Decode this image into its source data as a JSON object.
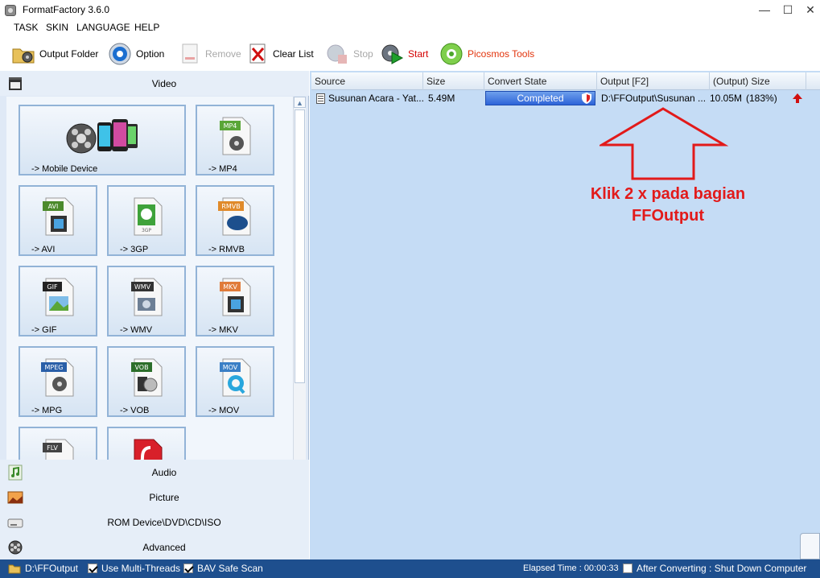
{
  "window": {
    "title": "FormatFactory 3.6.0",
    "controls": [
      "—",
      "☐",
      "✕"
    ]
  },
  "menu": [
    "TASK",
    "SKIN",
    "LANGUAGE",
    "HELP"
  ],
  "toolbar": {
    "output_folder": "Output Folder",
    "option": "Option",
    "remove": "Remove",
    "clear_list": "Clear List",
    "stop": "Stop",
    "start": "Start",
    "picosmos": "Picosmos Tools"
  },
  "categories": {
    "video": "Video",
    "audio": "Audio",
    "picture": "Picture",
    "rom": "ROM Device\\DVD\\CD\\ISO",
    "advanced": "Advanced"
  },
  "formats": {
    "mobile": "-> Mobile Device",
    "mp4": "-> MP4",
    "avi": "-> AVI",
    "gp3": "-> 3GP",
    "rmvb": "-> RMVB",
    "gif": "-> GIF",
    "wmv": "-> WMV",
    "mkv": "-> MKV",
    "mpg": "-> MPG",
    "vob": "-> VOB",
    "mov": "-> MOV"
  },
  "format_badges": {
    "mp4": "MP4",
    "avi": "AVI",
    "gp3": "3GP",
    "rmvb": "RMVB",
    "gif": "GIF",
    "wmv": "WMV",
    "mkv": "MKV",
    "mpeg": "MPEG",
    "vob": "VOB",
    "mov": "MOV",
    "flv": "FLV"
  },
  "list": {
    "columns": [
      "Source",
      "Size",
      "Convert State",
      "Output [F2]",
      "(Output) Size"
    ],
    "rows": [
      {
        "source": "Susunan Acara - Yat...",
        "size": "5.49M",
        "state": "Completed",
        "output": "D:\\FFOutput\\Susunan ...",
        "output_size": "10.05M",
        "ratio": "(183%)"
      }
    ]
  },
  "annotation": {
    "line1": "Klik 2 x pada bagian",
    "line2": "FFOutput",
    "color": "#e21a1a"
  },
  "status": {
    "output_path": "D:\\FFOutput",
    "multi_threads": "Use Multi-Threads",
    "bav_scan": "BAV Safe Scan",
    "elapsed": "Elapsed Time : 00:00:33",
    "after_converting": "After Converting : Shut Down Computer"
  },
  "colors": {
    "panel": "#c5dcf5",
    "statusbar": "#1e4f8e",
    "progress": "#2d63d8"
  }
}
